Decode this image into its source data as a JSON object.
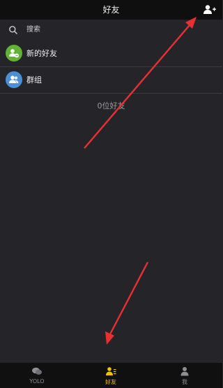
{
  "header": {
    "title": "好友"
  },
  "search": {
    "placeholder": "搜索"
  },
  "list": {
    "new_friends_label": "新的好友",
    "groups_label": "群组"
  },
  "friend_count_text": "0位好友",
  "tabs": [
    {
      "label": "YOLO",
      "icon": "chat-bubbles-icon",
      "active": false
    },
    {
      "label": "好友",
      "icon": "contacts-icon",
      "active": true
    },
    {
      "label": "我",
      "icon": "profile-icon",
      "active": false
    }
  ],
  "colors": {
    "accent": "#f2c200",
    "new_friends_avatar": "#62b233",
    "groups_avatar": "#4a8fd8",
    "annotation_arrow": "#e83030"
  }
}
